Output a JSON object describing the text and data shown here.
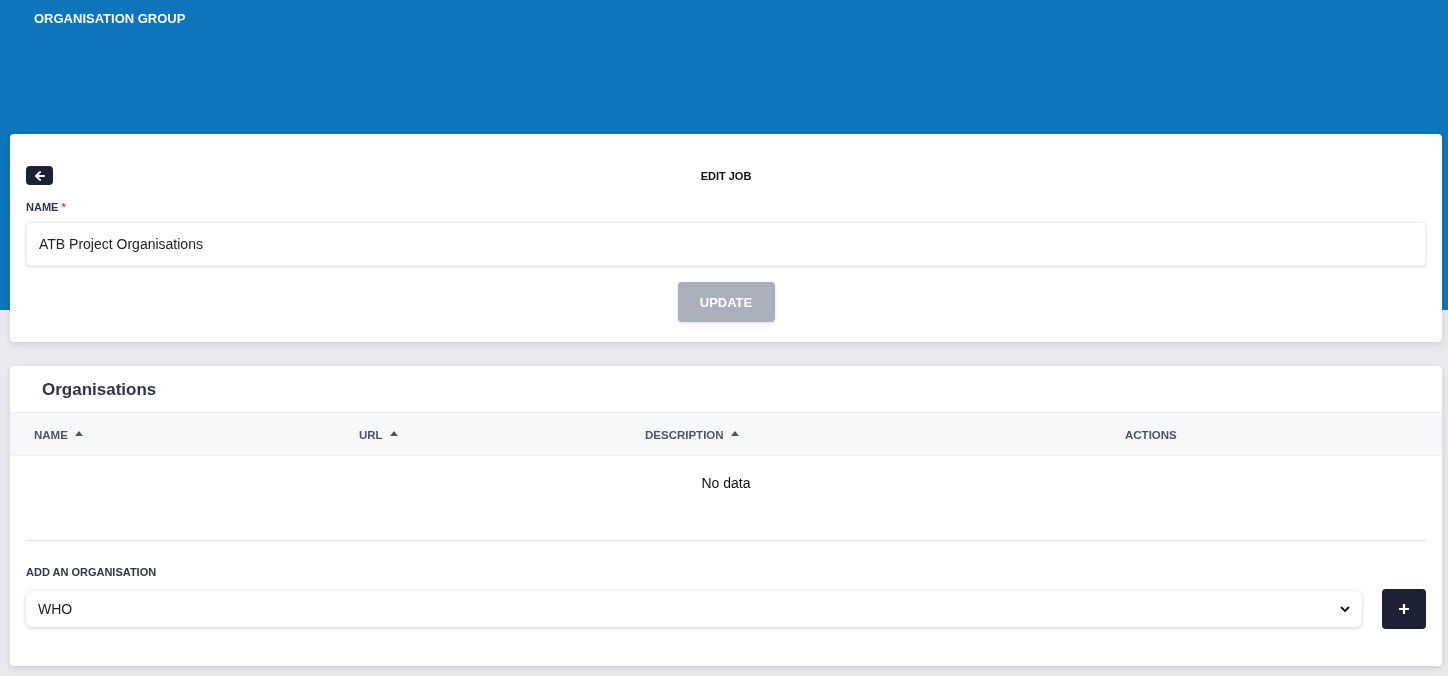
{
  "header": {
    "title": "ORGANISATION GROUP"
  },
  "edit_card": {
    "title": "EDIT JOB",
    "name_label": "NAME",
    "required_mark": "*",
    "name_value": "ATB Project Organisations",
    "update_button": {
      "label": "UPDATE",
      "disabled": true
    }
  },
  "organisations": {
    "title": "Organisations",
    "columns": [
      {
        "label": "NAME",
        "sortable": true
      },
      {
        "label": "URL",
        "sortable": true
      },
      {
        "label": "DESCRIPTION",
        "sortable": true
      },
      {
        "label": "ACTIONS",
        "sortable": false
      }
    ],
    "empty_text": "No data",
    "add_label": "ADD AN ORGANISATION",
    "add_value": "WHO"
  }
}
